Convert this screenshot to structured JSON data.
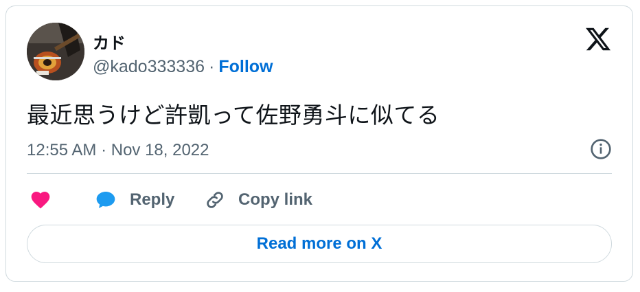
{
  "author": {
    "display_name": "カド",
    "handle": "@kado333336",
    "separator": "·",
    "follow_label": "Follow"
  },
  "tweet": {
    "text": "最近思うけど許凱って佐野勇斗に似てる",
    "timestamp": "12:55 AM · Nov 18, 2022"
  },
  "actions": {
    "like_icon": "heart-icon",
    "reply_label": "Reply",
    "copy_link_label": "Copy link"
  },
  "read_more_label": "Read more on X",
  "colors": {
    "text": "#0f1419",
    "secondary": "#536471",
    "link": "#006fd6",
    "heart": "#f91880",
    "reply_bubble": "#1d9bf0",
    "border": "#cfd9de"
  }
}
